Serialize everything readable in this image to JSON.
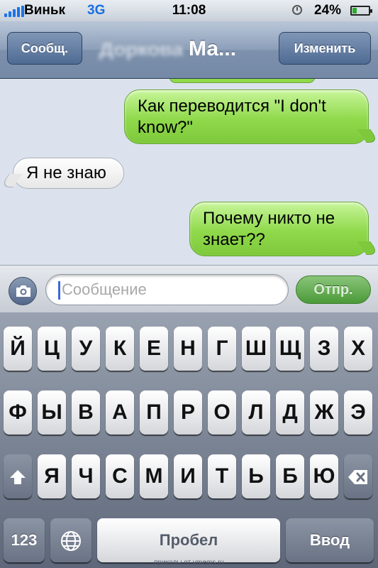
{
  "status_bar": {
    "carrier": "Виньк",
    "network": "3G",
    "time": "11:08",
    "battery": "24%"
  },
  "nav": {
    "back_label": "Сообщ.",
    "title_blurred": "Доркова",
    "title_visible": "Ма...",
    "edit_label": "Изменить"
  },
  "messages": [
    {
      "direction": "out",
      "text_lines": [
        "Как переводится \"I don't",
        "know?\""
      ]
    },
    {
      "direction": "in",
      "text_lines": [
        "Я не знаю"
      ]
    },
    {
      "direction": "out",
      "text_lines": [
        "Почему никто не",
        "знает??"
      ]
    }
  ],
  "composer": {
    "placeholder": "Сообщение",
    "send_label": "Отпр."
  },
  "keyboard": {
    "row1": [
      "Й",
      "Ц",
      "У",
      "К",
      "Е",
      "Н",
      "Г",
      "Ш",
      "Щ",
      "З",
      "Х"
    ],
    "row2": [
      "Ф",
      "Ы",
      "В",
      "А",
      "П",
      "Р",
      "О",
      "Л",
      "Д",
      "Ж",
      "Э"
    ],
    "row3": [
      "Я",
      "Ч",
      "С",
      "М",
      "И",
      "Т",
      "Ь",
      "Б",
      "Ю"
    ],
    "numbers_label": "123",
    "space_label": "Пробел",
    "return_label": "Ввод",
    "shift_icon": "shift-arrow-icon",
    "delete_icon": "backspace-icon",
    "globe_icon": "globe-icon"
  },
  "watermark": "приколы от vmems.ru",
  "colors": {
    "outgoing_bubble": "#8fd94b",
    "incoming_bubble": "#ffffff",
    "conversation_bg": "#dbe2ed",
    "nav_button": "#4f6b93",
    "send_button": "#4b9a38"
  }
}
